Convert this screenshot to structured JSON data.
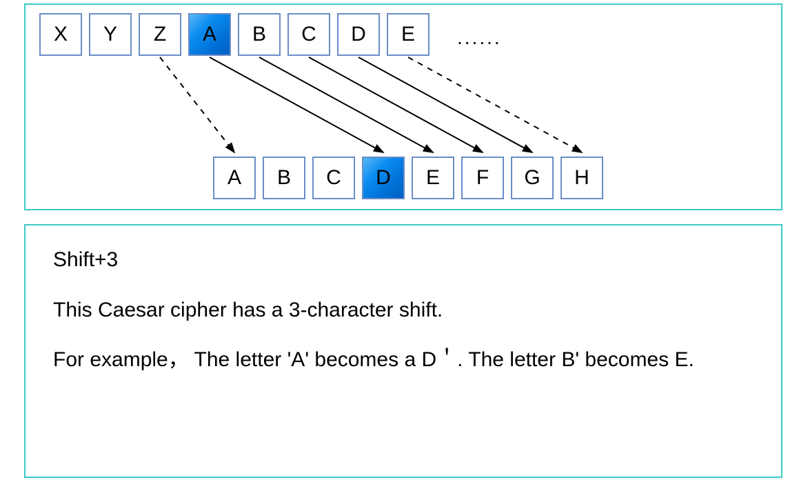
{
  "diagram": {
    "top_row": [
      "X",
      "Y",
      "Z",
      "A",
      "B",
      "C",
      "D",
      "E"
    ],
    "top_highlight_index": 3,
    "top_ellipsis": "......",
    "bottom_row": [
      "A",
      "B",
      "C",
      "D",
      "E",
      "F",
      "G",
      "H"
    ],
    "bottom_highlight_index": 3,
    "arrows": [
      {
        "from_top_index": 2,
        "to_bottom_index": 0,
        "style": "dashed"
      },
      {
        "from_top_index": 3,
        "to_bottom_index": 3,
        "style": "solid"
      },
      {
        "from_top_index": 4,
        "to_bottom_index": 4,
        "style": "solid"
      },
      {
        "from_top_index": 5,
        "to_bottom_index": 5,
        "style": "solid"
      },
      {
        "from_top_index": 6,
        "to_bottom_index": 6,
        "style": "solid"
      },
      {
        "from_top_index": 7,
        "to_bottom_index": 7,
        "style": "dashed"
      }
    ],
    "shift_amount": 3
  },
  "text": {
    "line1": "Shift+3",
    "line2": "This Caesar cipher has a 3-character shift.",
    "line3": "For example， The letter 'A' becomes a D＇. The letter B' becomes E."
  }
}
